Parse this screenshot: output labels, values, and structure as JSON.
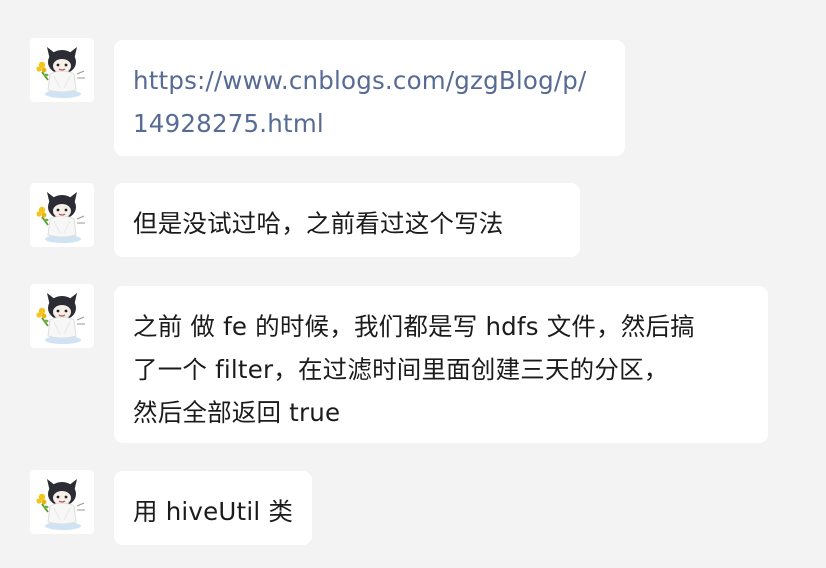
{
  "messages": [
    {
      "type": "link",
      "lines": [
        "https://www.cnblogs.com/gzgBlog/p/",
        "14928275.html"
      ]
    },
    {
      "type": "text",
      "lines": [
        "但是没试过哈，之前看过这个写法"
      ]
    },
    {
      "type": "text",
      "lines": [
        "之前 做 fe 的时候，我们都是写 hdfs 文件，然后搞",
        "了一个 filter，在过滤时间里面创建三天的分区，",
        "然后全部返回 true"
      ]
    },
    {
      "type": "text",
      "lines": [
        "用 hiveUtil 类"
      ]
    }
  ],
  "colors": {
    "background": "#f3f3f3",
    "bubble": "#ffffff",
    "text": "#1b1b1b",
    "link": "#576b95"
  },
  "icons": {
    "avatar": "cartoon-cat-avatar-icon"
  }
}
